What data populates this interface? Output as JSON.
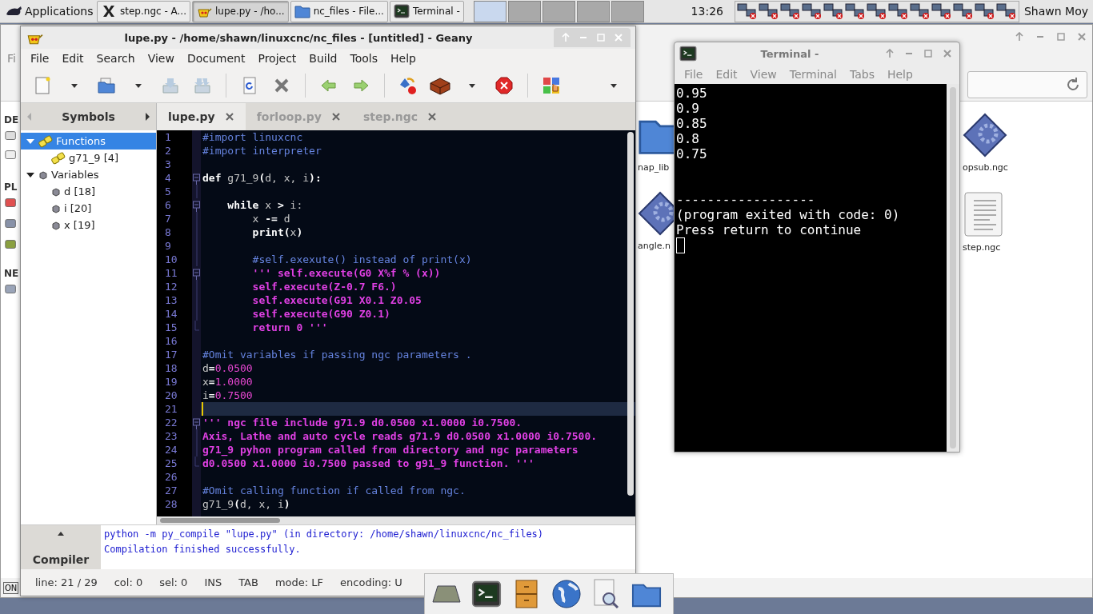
{
  "taskbar": {
    "menu": "Applications",
    "tasks": [
      {
        "label": "step.ngc - A...",
        "kind": "x",
        "selected": false
      },
      {
        "label": "lupe.py - /ho...",
        "kind": "geany",
        "selected": true
      },
      {
        "label": "nc_files - File...",
        "kind": "folder",
        "selected": false
      },
      {
        "label": "Terminal -",
        "kind": "terminal",
        "selected": false
      }
    ],
    "workspaces": [
      {
        "selected": true
      },
      {
        "selected": false
      },
      {
        "selected": false
      },
      {
        "selected": false
      },
      {
        "selected": false
      }
    ],
    "clock": "13:26",
    "user": "Shawn Moy"
  },
  "file_manager": {
    "menu": "Fi",
    "sections": [
      "DE",
      "PL",
      "NE"
    ],
    "files": [
      {
        "name": "nap_lib",
        "kind": "folder"
      },
      {
        "name": "angle.n",
        "kind": "gear"
      },
      {
        "name": "opsub.ngc",
        "kind": "gear"
      },
      {
        "name": "step.ngc",
        "kind": "text"
      }
    ],
    "status": "ON"
  },
  "geany": {
    "title": "lupe.py - /home/shawn/linuxcnc/nc_files - [untitled] - Geany",
    "menu": [
      "File",
      "Edit",
      "Search",
      "View",
      "Document",
      "Project",
      "Build",
      "Tools",
      "Help"
    ],
    "sidebar": {
      "tab": "Symbols",
      "tree": [
        {
          "label": "Functions",
          "kind": "function",
          "expanded": true,
          "selected": true,
          "children": [
            {
              "label": "g71_9 [4]",
              "kind": "function",
              "selected": false
            }
          ]
        },
        {
          "label": "Variables",
          "kind": "variable",
          "expanded": true,
          "selected": false,
          "children": [
            {
              "label": "d [18]",
              "kind": "variable",
              "selected": false
            },
            {
              "label": "i [20]",
              "kind": "variable",
              "selected": false
            },
            {
              "label": "x [19]",
              "kind": "variable",
              "selected": false
            }
          ]
        }
      ]
    },
    "tabs": [
      {
        "label": "lupe.py",
        "selected": true
      },
      {
        "label": "forloop.py",
        "selected": false
      },
      {
        "label": "step.ngc",
        "selected": false
      }
    ],
    "code": [
      {
        "n": "1",
        "kind": "none",
        "current": false,
        "segments": [
          {
            "kind": "comment",
            "text": "#import linuxcnc"
          }
        ]
      },
      {
        "n": "2",
        "kind": "none",
        "current": false,
        "segments": [
          {
            "kind": "comment",
            "text": "#import interpreter"
          }
        ]
      },
      {
        "n": "3",
        "kind": "none",
        "current": false
      },
      {
        "n": "4",
        "kind": "start",
        "current": false,
        "segments": [
          {
            "kind": "keyword",
            "text": "def"
          },
          {
            "kind": "plain",
            "text": " g71_9"
          },
          {
            "kind": "op",
            "text": "("
          },
          {
            "kind": "plain",
            "text": "d, x, i"
          },
          {
            "kind": "op",
            "text": "):"
          }
        ]
      },
      {
        "n": "5",
        "kind": "inside",
        "current": false
      },
      {
        "n": "6",
        "kind": "start",
        "current": false,
        "segments": [
          {
            "kind": "keyword",
            "text": "    while"
          },
          {
            "kind": "plain",
            "text": " x "
          },
          {
            "kind": "op",
            "text": ">"
          },
          {
            "kind": "plain",
            "text": " i:"
          }
        ]
      },
      {
        "n": "7",
        "kind": "inside",
        "current": false,
        "segments": [
          {
            "kind": "plain",
            "text": "        x "
          },
          {
            "kind": "op",
            "text": "-="
          },
          {
            "kind": "plain",
            "text": " d"
          }
        ]
      },
      {
        "n": "8",
        "kind": "inside",
        "current": false,
        "segments": [
          {
            "kind": "keyword",
            "text": "        print"
          },
          {
            "kind": "op",
            "text": "("
          },
          {
            "kind": "plain",
            "text": "x"
          },
          {
            "kind": "op",
            "text": ")"
          }
        ]
      },
      {
        "n": "9",
        "kind": "inside",
        "current": false
      },
      {
        "n": "10",
        "kind": "inside",
        "current": false,
        "segments": [
          {
            "kind": "comment",
            "text": "        #self.exexute() instead of print(x)"
          }
        ]
      },
      {
        "n": "11",
        "kind": "start",
        "current": false,
        "segments": [
          {
            "kind": "string",
            "text": "        ''' self.execute(G0 X%f % (x))"
          }
        ]
      },
      {
        "n": "12",
        "kind": "inside",
        "current": false,
        "segments": [
          {
            "kind": "string",
            "text": "        self.execute(Z-0.7 F6.)"
          }
        ]
      },
      {
        "n": "13",
        "kind": "inside",
        "current": false,
        "segments": [
          {
            "kind": "string",
            "text": "        self.execute(G91 X0.1 Z0.05"
          }
        ]
      },
      {
        "n": "14",
        "kind": "inside",
        "current": false,
        "segments": [
          {
            "kind": "string",
            "text": "        self.execute(G90 Z0.1)"
          }
        ]
      },
      {
        "n": "15",
        "kind": "end",
        "current": false,
        "segments": [
          {
            "kind": "string",
            "text": "        return 0 '''"
          }
        ]
      },
      {
        "n": "16",
        "kind": "none",
        "current": false
      },
      {
        "n": "17",
        "kind": "none",
        "current": false,
        "segments": [
          {
            "kind": "comment",
            "text": "#Omit variables if passing ngc parameters ."
          }
        ]
      },
      {
        "n": "18",
        "kind": "none",
        "current": false,
        "segments": [
          {
            "kind": "plain",
            "text": "d"
          },
          {
            "kind": "op",
            "text": "="
          },
          {
            "kind": "number",
            "text": "0.0500"
          }
        ]
      },
      {
        "n": "19",
        "kind": "none",
        "current": false,
        "segments": [
          {
            "kind": "plain",
            "text": "x"
          },
          {
            "kind": "op",
            "text": "="
          },
          {
            "kind": "number",
            "text": "1.0000"
          }
        ]
      },
      {
        "n": "20",
        "kind": "none",
        "current": false,
        "segments": [
          {
            "kind": "plain",
            "text": "i"
          },
          {
            "kind": "op",
            "text": "="
          },
          {
            "kind": "number",
            "text": "0.7500"
          }
        ]
      },
      {
        "n": "21",
        "kind": "none",
        "current": true
      },
      {
        "n": "22",
        "kind": "start",
        "current": false,
        "segments": [
          {
            "kind": "string",
            "text": "''' ngc file include g71.9 d0.0500 x1.0000 i0.7500."
          }
        ]
      },
      {
        "n": "23",
        "kind": "inside",
        "current": false,
        "segments": [
          {
            "kind": "string",
            "text": "Axis, Lathe and auto cycle reads g71.9 d0.0500 x1.0000 i0.7500."
          }
        ]
      },
      {
        "n": "24",
        "kind": "inside",
        "current": false,
        "segments": [
          {
            "kind": "string",
            "text": "g71_9 pyhon program called from directory and ngc parameters"
          }
        ]
      },
      {
        "n": "25",
        "kind": "end",
        "current": false,
        "segments": [
          {
            "kind": "string",
            "text": "d0.0500 x1.0000 i0.7500 passed to g91_9 function. '''"
          }
        ]
      },
      {
        "n": "26",
        "kind": "none",
        "current": false
      },
      {
        "n": "27",
        "kind": "none",
        "current": false,
        "segments": [
          {
            "kind": "comment",
            "text": "#Omit calling function if called from ngc."
          }
        ]
      },
      {
        "n": "28",
        "kind": "none",
        "current": false,
        "segments": [
          {
            "kind": "plain",
            "text": "g71_9"
          },
          {
            "kind": "op",
            "text": "("
          },
          {
            "kind": "plain",
            "text": "d, x, i"
          },
          {
            "kind": "op",
            "text": ")"
          }
        ]
      }
    ],
    "messages": {
      "tab": "Compiler",
      "lines": [
        "python -m py_compile \"lupe.py\" (in directory: /home/shawn/linuxcnc/nc_files)",
        "Compilation finished successfully."
      ]
    },
    "status": [
      "line: 21 / 29",
      "col: 0",
      "sel: 0",
      "INS",
      "TAB",
      "mode: LF",
      "encoding: U"
    ]
  },
  "terminal": {
    "title": "Terminal -",
    "menu": [
      "File",
      "Edit",
      "View",
      "Terminal",
      "Tabs",
      "Help"
    ],
    "blocks": [
      {
        "lines": [
          "0.95",
          "0.9",
          "0.85",
          "0.8",
          "0.75"
        ]
      },
      {
        "lines": [
          "------------------",
          "(program exited with code: 0)",
          "Press return to continue"
        ]
      }
    ]
  }
}
